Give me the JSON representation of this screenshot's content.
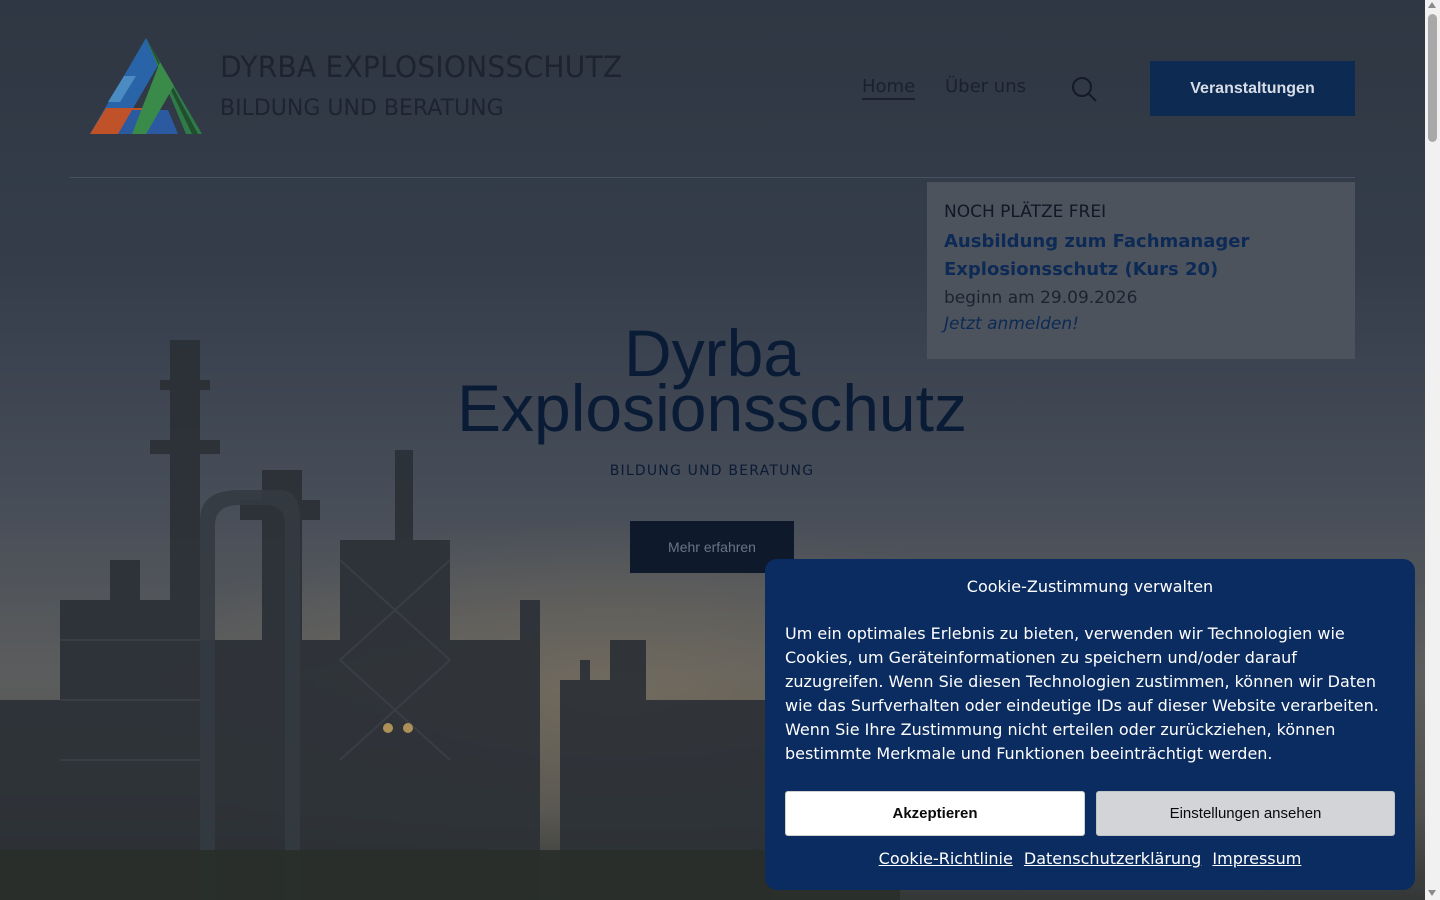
{
  "header": {
    "logo_line1": "DYRBA EXPLOSIONSSCHUTZ",
    "logo_line2": "BILDUNG UND BERATUNG",
    "nav": {
      "home": "Home",
      "about": "Über uns"
    },
    "events_button": "Veranstaltungen",
    "search_icon": "search-icon"
  },
  "promo": {
    "tag": "NOCH PLÄTZE FREI",
    "link": "Ausbildung zum Fachmanager Explosionsschutz (Kurs 20)",
    "date": "beginn am 29.09.2026",
    "cta": "Jetzt anmelden!"
  },
  "hero": {
    "title_line1": "Dyrba",
    "title_line2": "Explosionsschutz",
    "subtitle": "BILDUNG UND BERATUNG",
    "button": "Mehr erfahren"
  },
  "cookie": {
    "title": "Cookie-Zustimmung verwalten",
    "text": "Um ein optimales Erlebnis zu bieten, verwenden wir Technologien wie Cookies, um Geräteinformationen zu speichern und/oder darauf zuzugreifen. Wenn Sie diesen Technologien zustimmen, können wir Daten wie das Surfverhalten oder eindeutige IDs auf dieser Website verarbeiten. Wenn Sie Ihre Zustimmung nicht erteilen oder zurückziehen, können bestimmte Merkmale und Funktionen beeinträchtigt werden.",
    "accept": "Akzeptieren",
    "settings": "Einstellungen ansehen",
    "links": {
      "policy": "Cookie-Richtlinie",
      "privacy": "Datenschutzerklärung",
      "imprint": "Impressum"
    }
  },
  "colors": {
    "brand_navy": "#0c2a52",
    "cookie_bg": "#0b2c60",
    "promo_link": "#0c2a55"
  }
}
